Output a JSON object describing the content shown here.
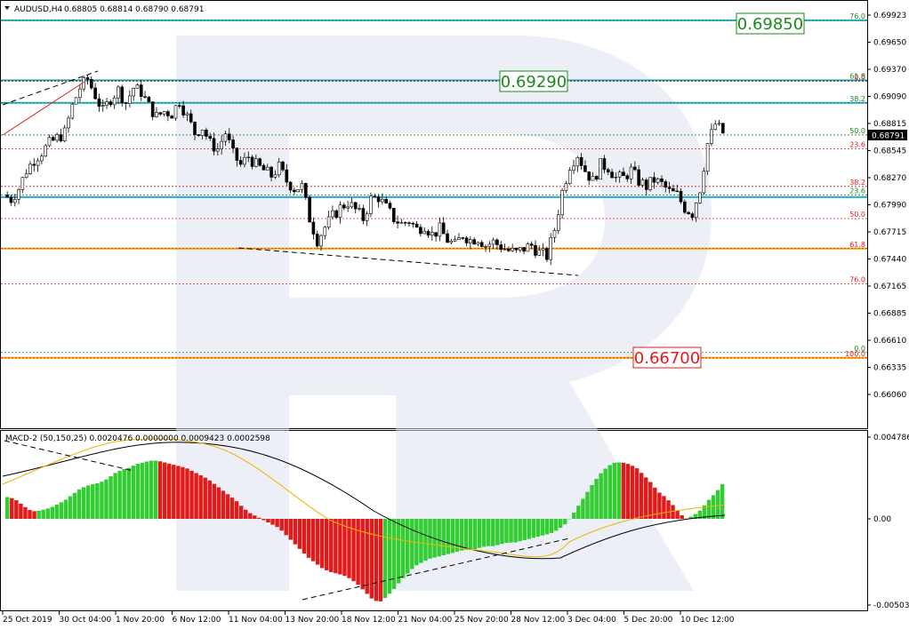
{
  "header": {
    "title": "AUDUSD,H4",
    "ohlc": "0.68805 0.68814 0.68790 0.68791"
  },
  "macd_header": "MACD-2 (50,150,25) 0.0020476 0.0000000 0.0009423 0.0002598",
  "current_price": "0.68791",
  "targets": [
    {
      "label": "0.69850",
      "color": "#1a8a1a"
    },
    {
      "label": "0.69290",
      "color": "#1a8a1a"
    },
    {
      "label": "0.66700",
      "color": "#e01b1b"
    }
  ],
  "chart_data": [
    {
      "type": "candlestick",
      "title": "AUDUSD,H4",
      "x_tick_labels": [
        "25 Oct 2019",
        "30 Oct 04:00",
        "1 Nov 20:00",
        "6 Nov 12:00",
        "11 Nov 04:00",
        "13 Nov 20:00",
        "18 Nov 12:00",
        "21 Nov 04:00",
        "25 Nov 20:00",
        "28 Nov 12:00",
        "3 Dec 04:00",
        "5 Dec 20:00",
        "10 Dec 12:00"
      ],
      "y_tick_labels": [
        "0.69923",
        "0.69650",
        "0.69370",
        "0.69090",
        "0.68815",
        "0.68545",
        "0.68270",
        "0.67990",
        "0.67715",
        "0.67440",
        "0.67165",
        "0.66885",
        "0.66610",
        "0.66335",
        "0.66060"
      ],
      "ylim": [
        0.6606,
        0.6999
      ],
      "close_path": [
        0.6822,
        0.6818,
        0.6828,
        0.6845,
        0.6855,
        0.6862,
        0.687,
        0.6875,
        0.688,
        0.6905,
        0.6922,
        0.693,
        0.6915,
        0.69,
        0.6912,
        0.692,
        0.6908,
        0.6922,
        0.6918,
        0.6905,
        0.6895,
        0.69,
        0.6898,
        0.691,
        0.6895,
        0.688,
        0.6885,
        0.687,
        0.6865,
        0.688,
        0.686,
        0.685,
        0.6858,
        0.685,
        0.6845,
        0.684,
        0.6848,
        0.6835,
        0.6828,
        0.683,
        0.68,
        0.678,
        0.6792,
        0.6802,
        0.681,
        0.6815,
        0.6808,
        0.68,
        0.6818,
        0.682,
        0.681,
        0.68,
        0.6795,
        0.6798,
        0.679,
        0.6794,
        0.6785,
        0.679,
        0.678,
        0.6775,
        0.6785,
        0.678,
        0.6782,
        0.6775,
        0.6778,
        0.6774,
        0.677,
        0.6768,
        0.6772,
        0.6775,
        0.6768,
        0.6765,
        0.679,
        0.6825,
        0.685,
        0.686,
        0.6845,
        0.6835,
        0.685,
        0.6848,
        0.6838,
        0.6838,
        0.6845,
        0.6835,
        0.683,
        0.6836,
        0.6832,
        0.6825,
        0.6822,
        0.681,
        0.6805,
        0.6828,
        0.687,
        0.6888,
        0.688
      ],
      "fib_levels_left": [
        {
          "label": "76.0",
          "price": 0.6739,
          "color": "#e01b1b"
        },
        {
          "label": "61.8",
          "price": 0.6772,
          "color": "#e01b1b"
        },
        {
          "label": "50.0",
          "price": 0.68,
          "color": "#e01b1b"
        },
        {
          "label": "38.2",
          "price": 0.683,
          "color": "#e01b1b"
        },
        {
          "label": "23.6",
          "price": 0.6865,
          "color": "#e01b1b"
        },
        {
          "label": "0.0",
          "price": 0.6928,
          "color": "#e01b1b"
        }
      ],
      "fib_levels_right": [
        {
          "label": "76.0",
          "price": 0.6985,
          "color": "#1a8a1a"
        },
        {
          "label": "61.8",
          "price": 0.6929,
          "color": "#1a8a1a"
        },
        {
          "label": "50.0",
          "price": 0.6878,
          "color": "#1a8a1a"
        },
        {
          "label": "38.2",
          "price": 0.6908,
          "color": "#1a8a1a"
        },
        {
          "label": "23.6",
          "price": 0.6822,
          "color": "#1a8a1a"
        },
        {
          "label": "0.0",
          "price": 0.6675,
          "color": "#1a8a1a"
        },
        {
          "label": "100.0",
          "price": 0.667,
          "color": "#e01b1b"
        }
      ],
      "support_resistance": [
        {
          "price": 0.6985,
          "color": "#27a9d6"
        },
        {
          "price": 0.6929,
          "color": "#27a9d6"
        },
        {
          "price": 0.6908,
          "color": "#27a9d6"
        },
        {
          "price": 0.682,
          "color": "#27a9d6"
        },
        {
          "price": 0.6772,
          "color": "#ffa500"
        },
        {
          "price": 0.667,
          "color": "#ffa500"
        }
      ]
    },
    {
      "type": "histogram",
      "title": "MACD-2 (50,150,25) 0.0020476 0.0000000 0.0009423 0.0002598",
      "y_tick_labels": [
        "0.0047868",
        "0.00",
        "-0.0050303"
      ],
      "ylim": [
        -0.0050303,
        0.0047868
      ],
      "histogram": [
        0.0012,
        0.0011,
        0.0008,
        0.0005,
        0.0004,
        0.0005,
        0.0006,
        0.0008,
        0.001,
        0.0013,
        0.0016,
        0.0018,
        0.0019,
        0.002,
        0.0022,
        0.0025,
        0.0027,
        0.0028,
        0.003,
        0.0031,
        0.0032,
        0.0032,
        0.0031,
        0.003,
        0.0029,
        0.0028,
        0.0026,
        0.0024,
        0.0022,
        0.0019,
        0.0016,
        0.0013,
        0.001,
        0.0006,
        0.0003,
        0.0001,
        -0.0001,
        -0.0003,
        -0.0005,
        -0.0009,
        -0.0013,
        -0.0017,
        -0.0021,
        -0.0024,
        -0.0027,
        -0.0029,
        -0.003,
        -0.0031,
        -0.0033,
        -0.0036,
        -0.004,
        -0.0044,
        -0.0046,
        -0.0043,
        -0.0039,
        -0.0034,
        -0.003,
        -0.0026,
        -0.0024,
        -0.0022,
        -0.0021,
        -0.002,
        -0.0019,
        -0.0018,
        -0.0017,
        -0.0017,
        -0.0016,
        -0.0015,
        -0.0015,
        -0.0014,
        -0.0013,
        -0.0013,
        -0.0012,
        -0.0011,
        -0.001,
        -0.0009,
        -0.0008,
        -0.0006,
        -0.0003,
        0.0002,
        0.0008,
        0.0014,
        0.002,
        0.0025,
        0.0029,
        0.0031,
        0.0031,
        0.003,
        0.0028,
        0.0024,
        0.002,
        0.0015,
        0.0012,
        0.0008,
        0.0003,
        0.0,
        0.0002,
        0.0005,
        0.001,
        0.0014,
        0.0019
      ]
    }
  ]
}
